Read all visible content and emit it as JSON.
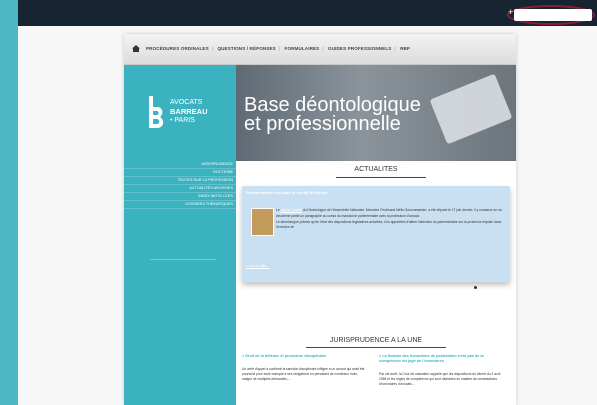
{
  "nav": {
    "links": [
      "PROCÉDURES ORDINALES",
      "QUESTIONS / RÉPONSES",
      "FORMULAIRES",
      "GUIDES PROFESSIONNELS",
      "RBP"
    ]
  },
  "brand": {
    "line1": "AVOCATS",
    "line2": "BARREAU",
    "line3": "• PARIS"
  },
  "banner": {
    "title_line1": "Base déontologique",
    "title_line2": "et professionnelle"
  },
  "sidebar": {
    "items": [
      "JURISPRUDENCE",
      "DOCTRINE",
      "TEXTES SUR LA PROFESSION",
      "ACTUALITÉS ARCHIVES",
      "INDEX MOTS-CLES",
      "DOSSIERS THÉMATIQUES"
    ]
  },
  "news": {
    "section_title": "ACTUALITES",
    "headline": "Parlementaires avocats et conflit d'intérêts",
    "body_start": "Le",
    "link": "rapport annuel",
    "body_text": "du Déontologue de l'Assemblée Nationale, Monsieur Ferdinand Mélin-Soucramanien, a été déposé le 17 juin dernier. Il y consacre en sa deuxième partie un paragraphe au cumul du mandat de parlementaire avec la profession d'avocat.",
    "body_text2": "Le déontologue précise qu'en l'état des dispositions législatives actuelles, il lui appartient d'attirer l'attention du parlementaire sur la prudence requise dans l'exercice de",
    "more": "> Lire la suite..."
  },
  "juris": {
    "section_title": "JURISPRUDENCE A LA UNE",
    "col1_title": "> Droit de la défense et procédure disciplinaire",
    "col1_text": "Un arrêt d'appel a confirmé la sanction disciplinaire infligée à un avocat qui avait été poursuivi pour avoir manqué à ses obligations en persistant de nombreux mois, malgré de multiples demandes,...",
    "col2_title": "> La fixation des honoraires de postulation n'est pas de la compétence du juge de l'honoraires",
    "col2_text": "Par cet arrêt, la Cour de cassation rappelle que les dispositions du décret du 2 avril 1968 et les règles de compétence qui sont distinctes en matière de contestations d'honoraires d'avocats..."
  },
  "colors": {
    "teal": "#3ab2bf",
    "topbar": "#172432",
    "highlight_ring": "#8a1f2f",
    "news_bg": "#c9dff2"
  }
}
